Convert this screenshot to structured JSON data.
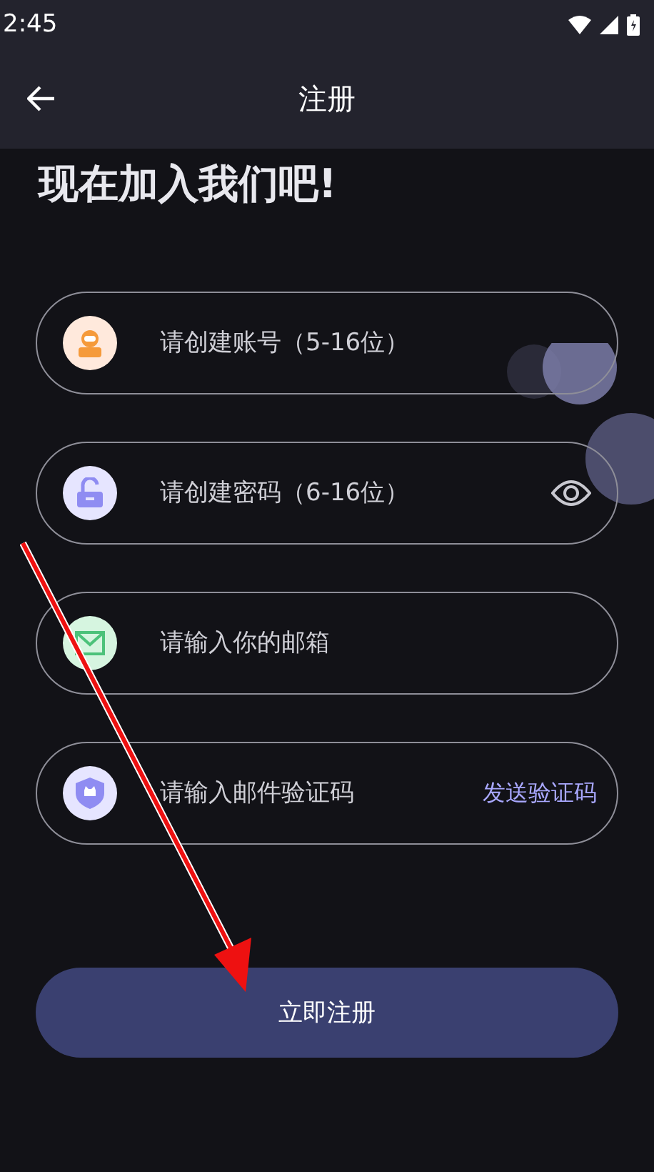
{
  "status_bar": {
    "time": "2:45"
  },
  "app_bar": {
    "title": "注册"
  },
  "heading": "现在加入我们吧!",
  "fields": [
    {
      "kind": "user",
      "placeholder": "请创建账号（5-16位）"
    },
    {
      "kind": "lock",
      "placeholder": "请创建密码（6-16位）",
      "trailing": {
        "kind": "eye"
      }
    },
    {
      "kind": "mail",
      "placeholder": "请输入你的邮箱"
    },
    {
      "kind": "shield",
      "placeholder": "请输入邮件验证码",
      "trailing": {
        "kind": "link",
        "label": "发送验证码"
      }
    }
  ],
  "submit": "立即注册"
}
